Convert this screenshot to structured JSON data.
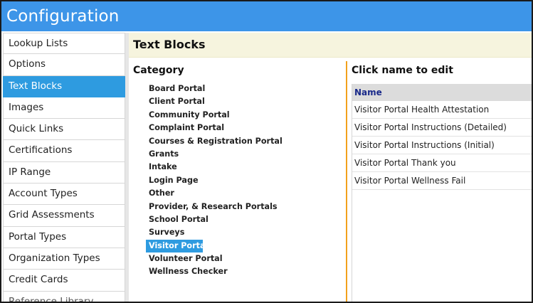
{
  "window": {
    "title": "Configuration"
  },
  "sidebar": {
    "items": [
      {
        "label": "Lookup Lists"
      },
      {
        "label": "Options"
      },
      {
        "label": "Text Blocks"
      },
      {
        "label": "Images"
      },
      {
        "label": "Quick Links"
      },
      {
        "label": "Certifications"
      },
      {
        "label": "IP Range"
      },
      {
        "label": "Account Types"
      },
      {
        "label": "Grid Assessments"
      },
      {
        "label": "Portal Types"
      },
      {
        "label": "Organization Types"
      },
      {
        "label": "Credit Cards"
      },
      {
        "label": "Reference Library"
      }
    ],
    "active_index": 2
  },
  "main": {
    "header": "Text Blocks",
    "category": {
      "title": "Category",
      "items": [
        "Board Portal",
        "Client Portal",
        "Community Portal",
        "Complaint Portal",
        "Courses & Registration Portal",
        "Grants",
        "Intake",
        "Login Page",
        "Other",
        "Provider, & Research Portals",
        "School Portal",
        "Surveys",
        "Visitor Portal",
        "Volunteer Portal",
        "Wellness Checker"
      ],
      "selected": "Visitor Portal"
    },
    "names": {
      "title": "Click name to edit",
      "column_header": "Name",
      "rows": [
        "Visitor Portal Health Attestation",
        "Visitor Portal Instructions (Detailed)",
        "Visitor Portal Instructions (Initial)",
        "Visitor Portal Thank you",
        "Visitor Portal Wellness Fail"
      ]
    }
  },
  "colors": {
    "titlebar": "#3d95e8",
    "active": "#2e9be0",
    "section_header_bg": "#f6f4de",
    "separator": "#f2a11c",
    "table_header_text": "#1a2a8a"
  }
}
